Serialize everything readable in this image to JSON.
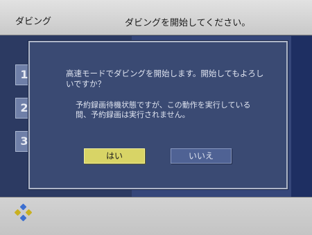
{
  "header": {
    "left_label": "ダビング",
    "instruction": "ダビングを開始してください。"
  },
  "background_items": [
    "1",
    "2",
    "3"
  ],
  "dialog": {
    "message": "高速モードでダビングを開始します。開始してもよろしいですか？",
    "note": "予約録画待機状態ですが、この動作を実行している間、予約録画は実行されません。",
    "yes_label": "はい",
    "no_label": "いいえ",
    "selected": "yes"
  },
  "footer": {
    "icon": "dpad-icon"
  },
  "colors": {
    "dialog_bg": "#3a4a73",
    "yes_button": "#d8d466",
    "no_button": "#4f6294",
    "topbar": "#d6d6d6"
  }
}
